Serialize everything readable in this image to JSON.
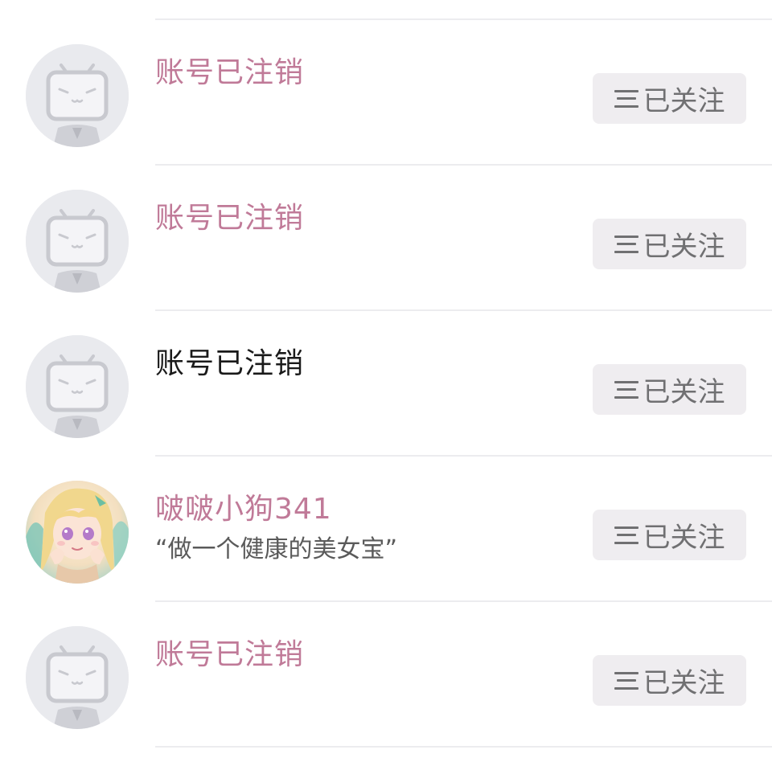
{
  "colors": {
    "highlight_name": "#c07a98",
    "plain_name": "#1a1a1a",
    "button_bg": "#efedf0",
    "button_text": "#707072",
    "divider": "#ececef"
  },
  "follow_list": [
    {
      "name": "账号已注销",
      "bio": "",
      "avatar_icon": "default-tv-avatar-icon",
      "name_style": "highlight",
      "button_icon": "menu-lines-icon",
      "button_label": "已关注"
    },
    {
      "name": "账号已注销",
      "bio": "",
      "avatar_icon": "default-tv-avatar-icon",
      "name_style": "highlight",
      "button_icon": "menu-lines-icon",
      "button_label": "已关注"
    },
    {
      "name": "账号已注销",
      "bio": "",
      "avatar_icon": "default-tv-avatar-icon",
      "name_style": "plain",
      "button_icon": "menu-lines-icon",
      "button_label": "已关注"
    },
    {
      "name": "啵啵小狗341",
      "bio": "“做一个健康的美女宝”",
      "avatar_icon": "anime-girl-avatar-icon",
      "name_style": "highlight",
      "button_icon": "menu-lines-icon",
      "button_label": "已关注"
    },
    {
      "name": "账号已注销",
      "bio": "",
      "avatar_icon": "default-tv-avatar-icon",
      "name_style": "highlight",
      "button_icon": "menu-lines-icon",
      "button_label": "已关注"
    }
  ]
}
